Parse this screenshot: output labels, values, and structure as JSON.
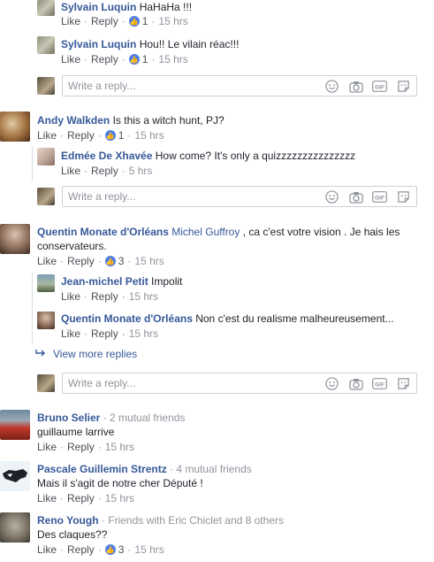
{
  "reply_placeholder": "Write a reply...",
  "actions": {
    "like": "Like",
    "reply": "Reply",
    "dot": "·"
  },
  "c1": {
    "name": "Sylvain Luquin",
    "text": "HaHaHa !!!",
    "likes": "1",
    "time": "15 hrs"
  },
  "c2": {
    "name": "Sylvain Luquin",
    "text": "Hou!! Le vilain réac!!!",
    "likes": "1",
    "time": "15 hrs"
  },
  "c3": {
    "name": "Andy Walkden",
    "text": "Is this a witch hunt, PJ?",
    "likes": "1",
    "time": "15 hrs"
  },
  "c4": {
    "name": "Edmée De Xhavée",
    "text": "How come? It's only a quizzzzzzzzzzzzzzz",
    "time": "5 hrs"
  },
  "c5": {
    "name": "Quentin Monate d'Orléans",
    "mention": "Michel Guffroy",
    "text1": " , ca c'est votre vision . Je hais les",
    "text2": "conservateurs.",
    "likes": "3",
    "time": "15 hrs"
  },
  "c6": {
    "name": "Jean-michel Petit",
    "text": "Impolit",
    "time": "15 hrs"
  },
  "c7": {
    "name": "Quentin Monate d'Orléans",
    "text": "Non c'est du realisme malheureusement...",
    "time": "15 hrs"
  },
  "view_more": "View more replies",
  "c8": {
    "name": "Bruno Selier",
    "sub": "· 2 mutual friends",
    "text": "guillaume larrive",
    "time": "15 hrs"
  },
  "c9": {
    "name": "Pascale Guillemin Strentz",
    "sub": "· 4 mutual friends",
    "text": "Mais il s'agit de notre cher Député !",
    "time": "15 hrs"
  },
  "c10": {
    "name": "Reno Yough",
    "sub": "· Friends with Eric Chiclet and 8 others",
    "text": "Des claques??",
    "likes": "3",
    "time": "15 hrs"
  },
  "colors": {
    "link": "#365899",
    "like_badge": "#4f7ee6",
    "border": "#ccd0d5"
  },
  "icons": [
    "emoji-icon",
    "camera-icon",
    "gif-icon",
    "sticker-icon",
    "reply-arrow-icon",
    "thumbs-up-icon"
  ]
}
